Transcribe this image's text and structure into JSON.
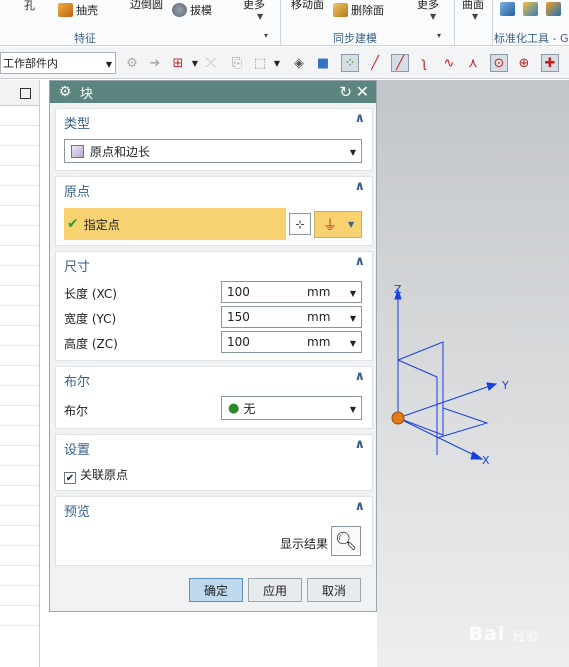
{
  "ribbon": {
    "item_hole": "孔",
    "item_shell": "抽壳",
    "item_edge_blend": "边倒圆",
    "item_draft": "拔模",
    "item_more1": "更多",
    "item_move_face": "移动面",
    "item_delete_face": "删除面",
    "item_more2": "更多",
    "item_surface": "曲面",
    "group_feature": "特征",
    "group_sync": "同步建模",
    "group_standard": "标准化工具 - G"
  },
  "toolbar": {
    "filter_value": "工作部件内"
  },
  "dialog": {
    "title": "块",
    "type_section": {
      "label": "类型",
      "selected": "原点和边长"
    },
    "origin_section": {
      "label": "原点",
      "specify_point": "指定点"
    },
    "size_section": {
      "label": "尺寸",
      "rows": [
        {
          "label": "长度 (XC)",
          "value": "100",
          "unit": "mm"
        },
        {
          "label": "宽度 (YC)",
          "value": "150",
          "unit": "mm"
        },
        {
          "label": "高度 (ZC)",
          "value": "100",
          "unit": "mm"
        }
      ]
    },
    "boolean_section": {
      "label": "布尔",
      "field_label": "布尔",
      "selected": "无"
    },
    "settings_section": {
      "label": "设置",
      "associative_origin": "关联原点",
      "associative_checked": true
    },
    "preview_section": {
      "label": "预览",
      "show_result": "显示结果"
    },
    "buttons": {
      "ok": "确定",
      "apply": "应用",
      "cancel": "取消"
    }
  },
  "viewport": {
    "axis_z": "Z",
    "axis_y": "Y",
    "axis_x": "X",
    "watermark": "Bai",
    "watermark_suffix": "经验"
  },
  "colors": {
    "dialog_title_bg": "#5d8580",
    "section_label": "#3a5f8a",
    "point_highlight": "#f8d271",
    "wcs_blue": "#1a3fe0",
    "origin_orange": "#e07a1a"
  }
}
